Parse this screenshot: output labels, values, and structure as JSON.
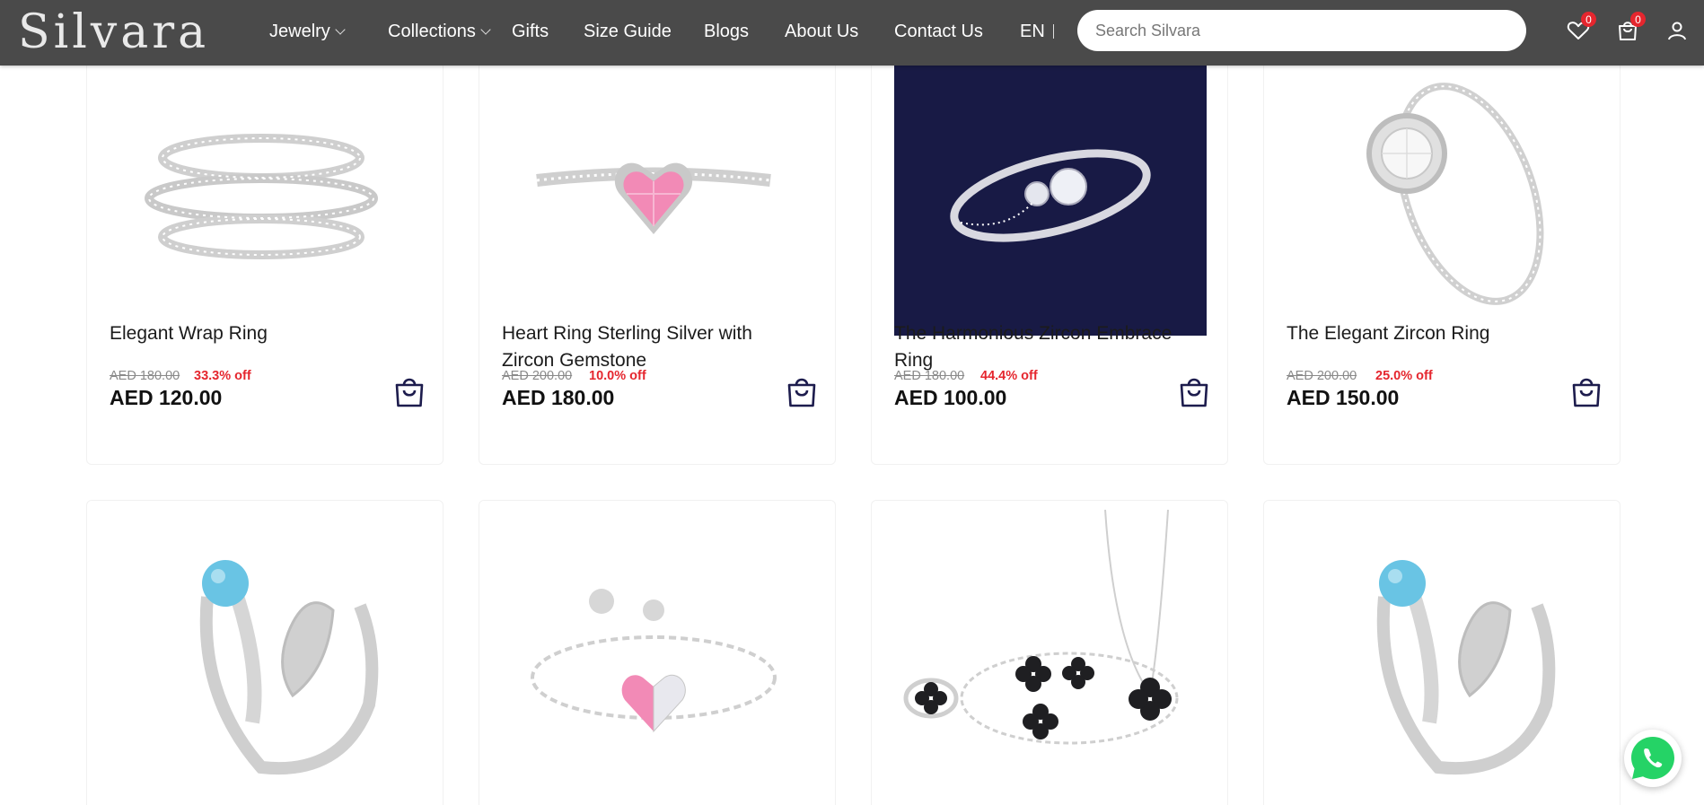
{
  "brand": {
    "logo_text": "Silvara"
  },
  "nav": {
    "items": [
      {
        "label": "Jewelry",
        "dropdown": true
      },
      {
        "label": "Collections",
        "dropdown": true
      },
      {
        "label": "Gifts"
      },
      {
        "label": "Size Guide"
      },
      {
        "label": "Blogs"
      },
      {
        "label": "About Us"
      },
      {
        "label": "Contact Us"
      }
    ],
    "language": "EN",
    "search_placeholder": "Search Silvara",
    "wishlist_count": "0",
    "cart_count": "0"
  },
  "products": [
    {
      "title": "Elegant Wrap Ring",
      "old_price": "AED 180.00",
      "discount": "33.3% off",
      "price": "AED 120.00",
      "image": "wrap-ring"
    },
    {
      "title": "Heart Ring Sterling Silver with Zircon Gemstone",
      "old_price": "AED 200.00",
      "discount": "10.0% off",
      "price": "AED 180.00",
      "image": "heart-ring"
    },
    {
      "title": "The Harmonious Zircon Embrace Ring",
      "old_price": "AED 180.00",
      "discount": "44.4% off",
      "price": "AED 100.00",
      "image": "embrace-ring"
    },
    {
      "title": "The Elegant Zircon Ring",
      "old_price": "AED 200.00",
      "discount": "25.0% off",
      "price": "AED 150.00",
      "image": "zircon-ring"
    },
    {
      "title": "",
      "image": "turquoise-leaf-ring"
    },
    {
      "title": "",
      "image": "heart-chain-ring"
    },
    {
      "title": "",
      "image": "clover-jewelry-set"
    },
    {
      "title": "",
      "image": "turquoise-leaf-ring"
    }
  ],
  "colors": {
    "nav_bg": "#4a4a4a",
    "accent_navy": "#1d1c4d",
    "discount_red": "#e5262e",
    "badge_red": "#e5262e",
    "whatsapp_green": "#25d366"
  }
}
